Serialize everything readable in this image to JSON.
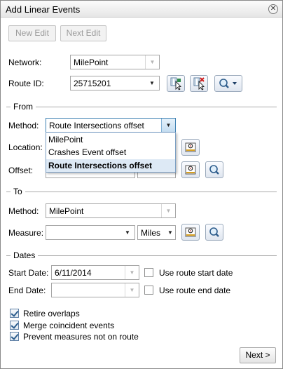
{
  "window": {
    "title": "Add Linear Events"
  },
  "toolbar": {
    "new_edit": "New Edit",
    "next_edit": "Next Edit"
  },
  "network": {
    "label": "Network:",
    "value": "MilePoint"
  },
  "route": {
    "label": "Route ID:",
    "value": "25715201"
  },
  "from": {
    "section": "From",
    "method_label": "Method:",
    "method_value": "Route Intersections offset",
    "location_label": "Location:",
    "offset_label": "Offset:",
    "options": [
      "MilePoint",
      "Crashes Event offset",
      "Route Intersections offset"
    ],
    "selected_index": 2
  },
  "to": {
    "section": "To",
    "method_label": "Method:",
    "method_value": "MilePoint",
    "measure_label": "Measure:",
    "measure_value": "",
    "units_value": "Miles"
  },
  "dates": {
    "section": "Dates",
    "start_label": "Start Date:",
    "start_value": "6/11/2014",
    "use_start": "Use route start date",
    "end_label": "End Date:",
    "end_value": "",
    "use_end": "Use route end date"
  },
  "options": {
    "retire": "Retire overlaps",
    "merge": "Merge coincident events",
    "prevent": "Prevent measures not on route"
  },
  "footer": {
    "next": "Next >"
  }
}
